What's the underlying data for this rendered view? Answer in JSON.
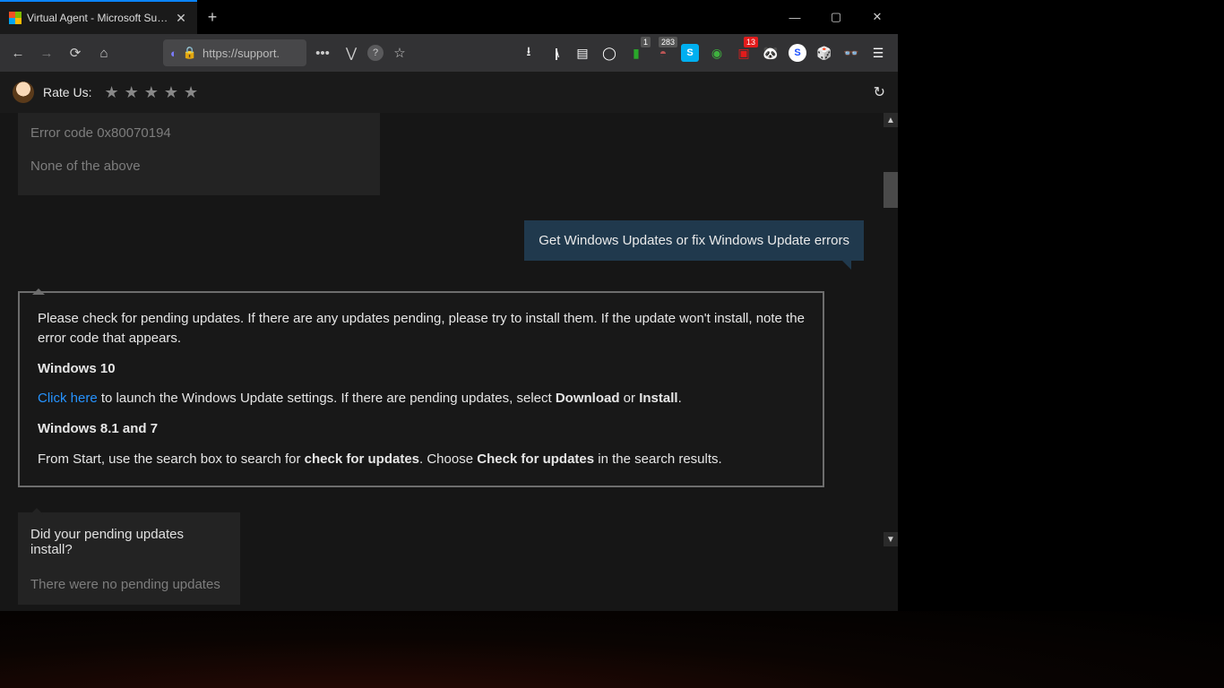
{
  "tab": {
    "title": "Virtual Agent - Microsoft Supp…"
  },
  "addressbar": {
    "url": "https://support."
  },
  "ext_badges": {
    "green": "1",
    "grey": "283",
    "red": "13"
  },
  "ratebar": {
    "label": "Rate Us:"
  },
  "old_options": {
    "opt1": "Error code 0x80070194",
    "opt2": "None of the above"
  },
  "user_msg": "Get Windows Updates or fix Windows Update errors",
  "agent": {
    "p1": "Please check for pending updates. If there are any updates pending, please try to install them. If the update won't install, note the error code that appears.",
    "h1": "Windows 10",
    "link": "Click here",
    "p2a": " to launch the Windows Update settings. If there are pending updates, select ",
    "b1": "Download",
    "p2b": " or ",
    "b2": "Install",
    "p2c": ".",
    "h2": "Windows 8.1 and 7",
    "p3a": "From Start, use the search box to search for ",
    "b3": "check for updates",
    "p3b": ". Choose ",
    "b4": "Check for updates",
    "p3c": " in the search results."
  },
  "followup": {
    "q": "Did your pending updates install?",
    "opt1": "There were no pending updates"
  }
}
